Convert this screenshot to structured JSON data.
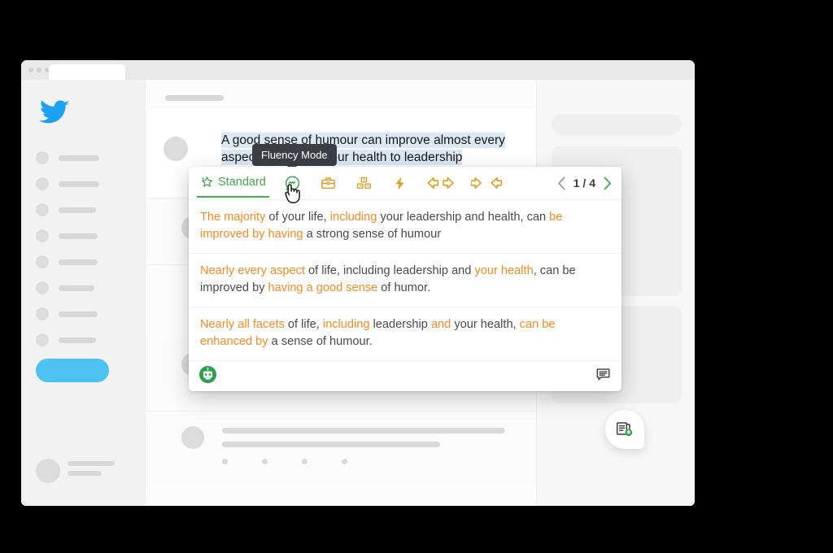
{
  "window": {
    "browser_chrome": {
      "tab_label": ""
    }
  },
  "sidebar": {
    "logo": "twitter-bird-icon",
    "items": [
      {
        "label": ""
      },
      {
        "label": ""
      },
      {
        "label": ""
      },
      {
        "label": ""
      },
      {
        "label": ""
      },
      {
        "label": ""
      },
      {
        "label": ""
      },
      {
        "label": ""
      }
    ],
    "primary_button_label": ""
  },
  "feed": {
    "compose": {
      "highlighted_text_line1": "A good sense of humour can improve almost every",
      "highlighted_text_line2": "aspect of life from your health to leadership"
    },
    "posts": [
      {
        "label": ""
      },
      {
        "label": ""
      },
      {
        "label": ""
      }
    ]
  },
  "tooltip": {
    "text": "Fluency Mode"
  },
  "popup": {
    "modes": [
      {
        "id": "standard",
        "label": "Standard",
        "icon": "sparkle-star-icon",
        "active": true,
        "color": "#48a14f"
      },
      {
        "id": "fluency",
        "label": "Fluency",
        "icon": "speech-bubble-squiggle-icon",
        "active": false,
        "color": "#4fa85a"
      },
      {
        "id": "formal",
        "label": "Formal",
        "icon": "briefcase-icon",
        "active": false,
        "color": "#d6a02a"
      },
      {
        "id": "simple",
        "label": "Simple",
        "icon": "building-blocks-icon",
        "active": false,
        "color": "#d6a02a"
      },
      {
        "id": "creative",
        "label": "Creative",
        "icon": "lightning-bolt-icon",
        "active": false,
        "color": "#d6a02a"
      },
      {
        "id": "expand",
        "label": "Expand",
        "icon": "arrows-outward-icon",
        "active": false,
        "color": "#d6a02a"
      },
      {
        "id": "shorten",
        "label": "Shorten",
        "icon": "arrows-inward-icon",
        "active": false,
        "color": "#d6a02a"
      }
    ],
    "pager": {
      "current": "1",
      "separator": "/",
      "total": "4",
      "text": "1 / 4"
    },
    "suggestions": [
      {
        "parts": [
          {
            "t": "The majority",
            "c": "orange"
          },
          {
            "t": " of your life, ",
            "c": "gray"
          },
          {
            "t": "including",
            "c": "orange"
          },
          {
            "t": " your leadership and health, can ",
            "c": "gray"
          },
          {
            "t": "be improved by having",
            "c": "orange"
          },
          {
            "t": " a strong sense of humour",
            "c": "gray"
          }
        ]
      },
      {
        "parts": [
          {
            "t": "Nearly every aspect",
            "c": "orange"
          },
          {
            "t": " of life, including leadership and ",
            "c": "gray"
          },
          {
            "t": "your health",
            "c": "orange"
          },
          {
            "t": ", can be improved by ",
            "c": "gray"
          },
          {
            "t": "having a good sense",
            "c": "orange"
          },
          {
            "t": " of humor.",
            "c": "gray"
          }
        ]
      },
      {
        "parts": [
          {
            "t": "Nearly all facets",
            "c": "orange"
          },
          {
            "t": " of life, ",
            "c": "gray"
          },
          {
            "t": "including",
            "c": "orange"
          },
          {
            "t": " leadership ",
            "c": "gray"
          },
          {
            "t": "and",
            "c": "orange"
          },
          {
            "t": " your health, ",
            "c": "gray"
          },
          {
            "t": "can be enhanced by",
            "c": "orange"
          },
          {
            "t": " a sense of humour.",
            "c": "gray"
          }
        ]
      }
    ],
    "footer": {
      "brand_icon": "quillbot-robot-icon",
      "feedback_icon": "feedback-comment-icon"
    }
  },
  "fab": {
    "icon": "paraphrase-document-icon"
  },
  "colors": {
    "accent_green": "#48a14f",
    "highlight_orange": "#f28b26",
    "twitter_blue": "#1da1f2",
    "mode_gold": "#d6a02a",
    "text_gray": "#4a4a4a",
    "selection_blue": "#dce8f3"
  }
}
